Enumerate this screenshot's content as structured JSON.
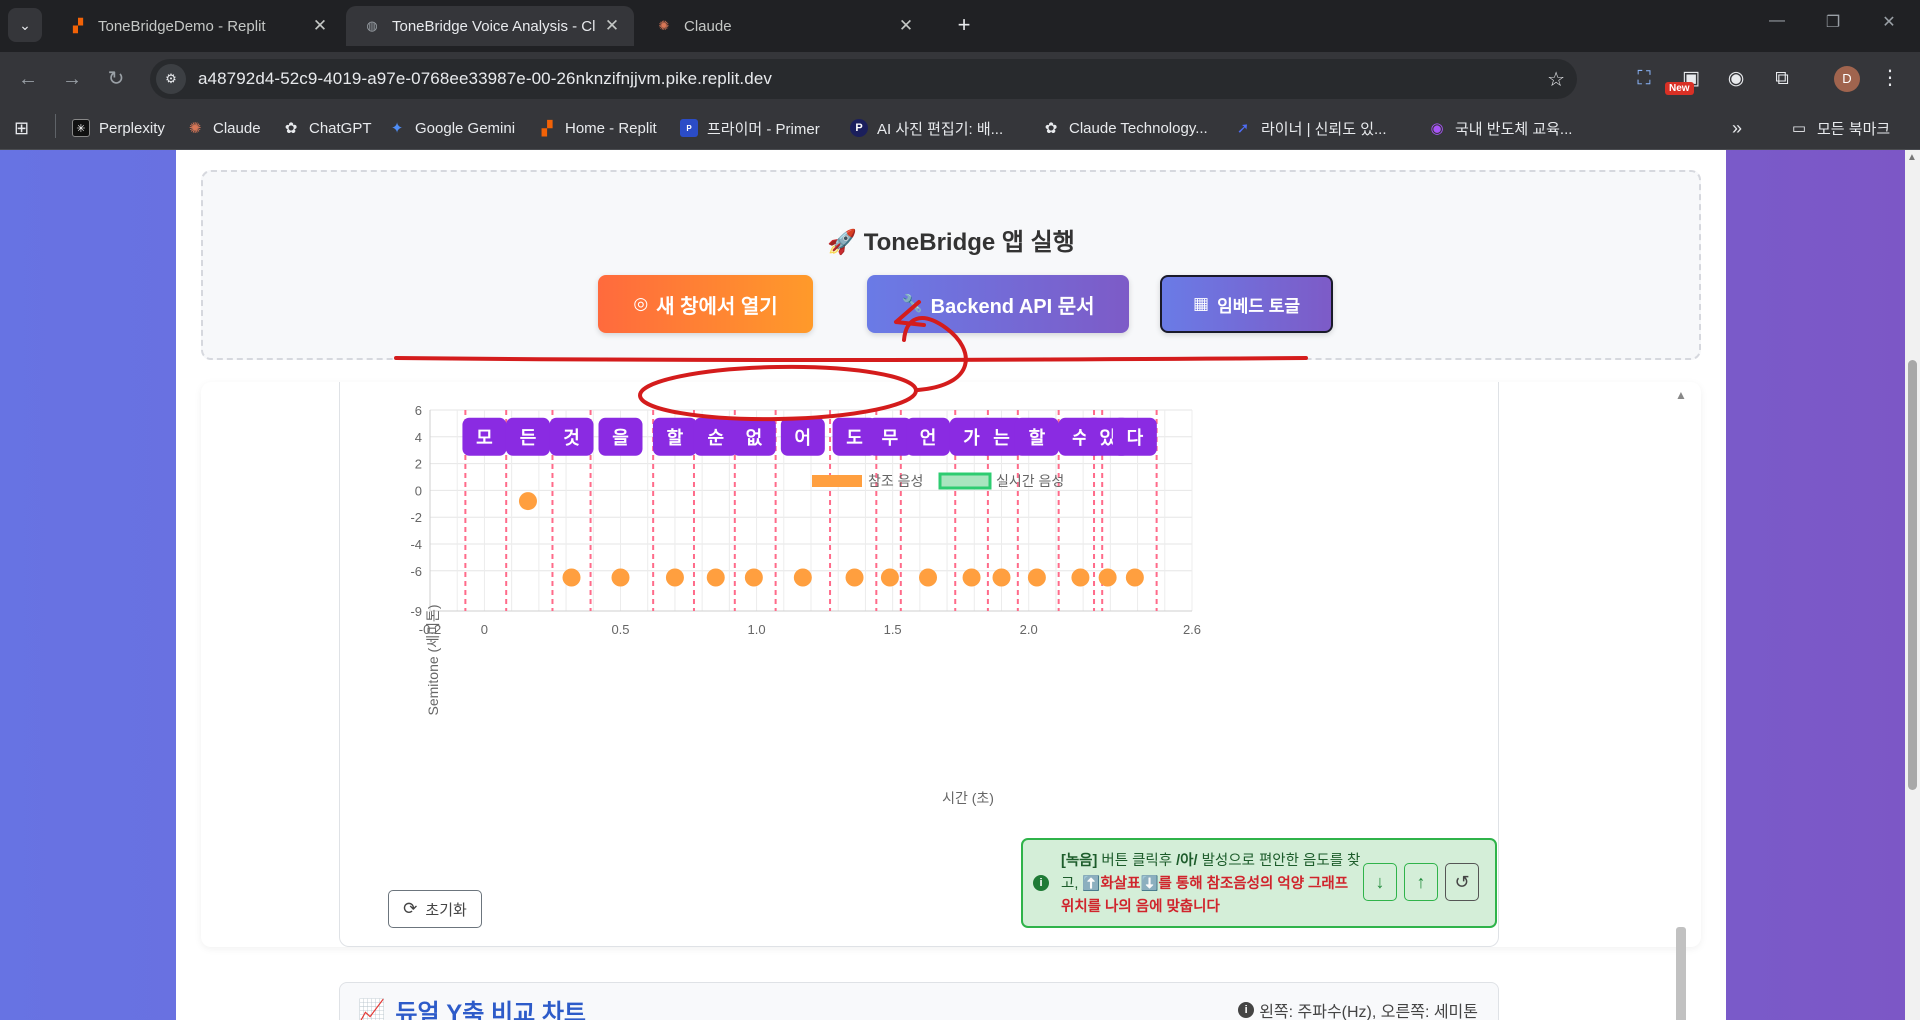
{
  "browser": {
    "tabs": [
      {
        "title": "ToneBridgeDemo - Replit",
        "active": false
      },
      {
        "title": "ToneBridge Voice Analysis - Cl",
        "active": true
      },
      {
        "title": "Claude",
        "active": false
      }
    ],
    "url": "a48792d4-52c9-4019-a97e-0768ee33987e-00-26nknzifnjjvm.pike.replit.dev",
    "extension_badge": "New",
    "avatar_letter": "D",
    "bookmarks": [
      {
        "label": "Perplexity",
        "icon": "perplexity-icon"
      },
      {
        "label": "Claude",
        "icon": "claude-icon"
      },
      {
        "label": "ChatGPT",
        "icon": "chatgpt-icon"
      },
      {
        "label": "Google Gemini",
        "icon": "gemini-icon"
      },
      {
        "label": "Home - Replit",
        "icon": "replit-icon"
      },
      {
        "label": "프라이머 - Primer",
        "icon": "primer-icon"
      },
      {
        "label": "AI 사진 편집기: 배...",
        "icon": "photo-editor-icon"
      },
      {
        "label": "Claude Technology...",
        "icon": "chatgpt-icon"
      },
      {
        "label": "라이너 | 신뢰도 있...",
        "icon": "liner-icon"
      },
      {
        "label": "국내 반도체 교육...",
        "icon": "semiconductor-icon"
      }
    ],
    "all_bookmarks": "모든 북마크"
  },
  "launch": {
    "title": "🚀 ToneBridge 앱 실행",
    "open_new_window": "새 창에서 열기",
    "backend_api_docs": "Backend API 문서",
    "embed_toggle": "임베드 토글"
  },
  "chart_data": {
    "type": "scatter",
    "legend": [
      "참조 음성",
      "실시간 음성"
    ],
    "xlabel": "시간 (초)",
    "ylabel": "Semitone (세미톤)",
    "xlim": [
      -0.2,
      2.6
    ],
    "ylim": [
      -9,
      6
    ],
    "x_ticks": [
      "-0.2",
      "0",
      "0.5",
      "1.0",
      "1.5",
      "2.0",
      "2.6"
    ],
    "y_ticks": [
      "6",
      "4",
      "2",
      "0",
      "-2",
      "-4",
      "-6",
      "-9"
    ],
    "syllables": [
      {
        "text": "모",
        "t": 0.0
      },
      {
        "text": "든",
        "t": 0.16
      },
      {
        "text": "것",
        "t": 0.32
      },
      {
        "text": "을",
        "t": 0.5
      },
      {
        "text": "할",
        "t": 0.7
      },
      {
        "text": "순",
        "t": 0.85
      },
      {
        "text": "없",
        "t": 0.99
      },
      {
        "text": "어",
        "t": 1.17
      },
      {
        "text": "도",
        "t": 1.36
      },
      {
        "text": "무",
        "t": 1.49
      },
      {
        "text": "언",
        "t": 1.63
      },
      {
        "text": "가",
        "t": 1.79
      },
      {
        "text": "는",
        "t": 1.9
      },
      {
        "text": "할",
        "t": 2.03
      },
      {
        "text": "수",
        "t": 2.19
      },
      {
        "text": "있",
        "t": 2.29
      },
      {
        "text": "다",
        "t": 2.39
      }
    ],
    "boundaries": [
      -0.07,
      0.08,
      0.25,
      0.39,
      0.62,
      0.77,
      0.92,
      1.07,
      1.27,
      1.44,
      1.53,
      1.73,
      1.85,
      1.96,
      2.11,
      2.24,
      2.27,
      2.47
    ],
    "reference_points": [
      {
        "x": 0.16,
        "y": -0.8
      },
      {
        "x": 0.32,
        "y": -6.5
      },
      {
        "x": 0.5,
        "y": -6.5
      },
      {
        "x": 0.7,
        "y": -6.5
      },
      {
        "x": 0.85,
        "y": -6.5
      },
      {
        "x": 0.99,
        "y": -6.5
      },
      {
        "x": 1.17,
        "y": -6.5
      },
      {
        "x": 1.36,
        "y": -6.5
      },
      {
        "x": 1.49,
        "y": -6.5
      },
      {
        "x": 1.63,
        "y": -6.5
      },
      {
        "x": 1.79,
        "y": -6.5
      },
      {
        "x": 1.9,
        "y": -6.5
      },
      {
        "x": 2.03,
        "y": -6.5
      },
      {
        "x": 2.19,
        "y": -6.5
      },
      {
        "x": 2.29,
        "y": -6.5
      },
      {
        "x": 2.39,
        "y": -6.5
      }
    ],
    "grid": true,
    "colors": {
      "reference": "#ff9f3f",
      "realtime": "#2ecc71",
      "syllable": "#8a2be2",
      "boundary": "#ff6b8a"
    }
  },
  "controls": {
    "reset_label": "초기화",
    "tip_bold": "[녹음]",
    "tip_text1": " 버튼 클릭후 ",
    "tip_vowel": "/아/",
    "tip_text2": " 발성으로 편안한 음도를 찾고, ",
    "tip_arrows": "⬆️화살표⬇️",
    "tip_red": "를 통해 참조음성의 억양 그래프 위치를 나의 음에 맞춥니다"
  },
  "dual_chart": {
    "title": "듀얼 Y축 비교 차트",
    "note": "왼쪽: 주파수(Hz), 오른쪽: 세미톤"
  }
}
